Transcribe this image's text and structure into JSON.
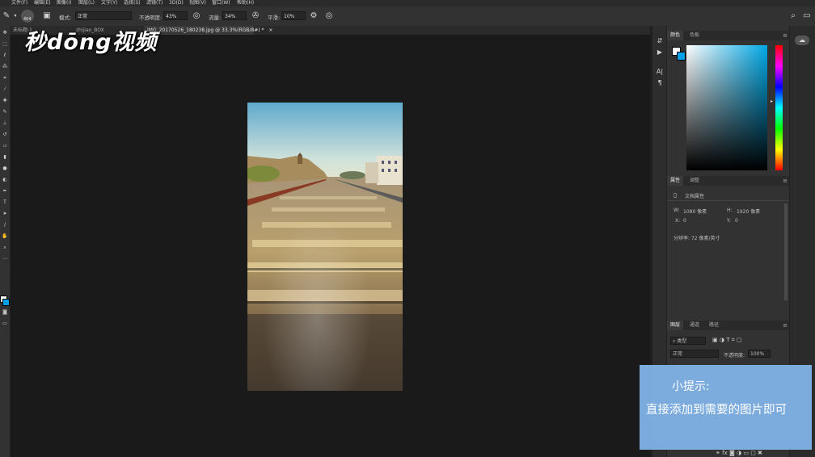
{
  "menu": [
    "文件(F)",
    "编辑(E)",
    "图像(I)",
    "图层(L)",
    "文字(Y)",
    "选择(S)",
    "滤镜(T)",
    "3D(D)",
    "视图(V)",
    "窗口(W)",
    "帮助(H)"
  ],
  "options": {
    "brush_size": "404",
    "mode_label": "模式:",
    "mode_value": "正常",
    "opacity_label": "不透明度:",
    "opacity_value": "43%",
    "flow_label": "流量:",
    "flow_value": "34%",
    "smooth_label": "平滑:",
    "smooth_value": "10%"
  },
  "tabs": [
    {
      "label": "未标题-1"
    },
    {
      "label": "zhijiao_BOX"
    },
    {
      "label": "IMG_20170526_180238.jpg @ 33.3%(RGB/8#) *"
    }
  ],
  "watermark": "秒dōng视频",
  "color_panel": {
    "tab_active": "颜色",
    "tab_other": "色板"
  },
  "properties_panel": {
    "tab_active": "属性",
    "tab_other": "调整",
    "doc_label": "文档属性",
    "w_label": "W:",
    "w_value": "1080 像素",
    "h_label": "H:",
    "h_value": "1920 像素",
    "x_label": "X:",
    "x_value": "0",
    "y_label": "Y:",
    "y_value": "0",
    "resolution": "分辨率: 72 像素/英寸"
  },
  "layers_panel": {
    "tabs": [
      "图层",
      "通道",
      "路径"
    ],
    "kind_label": "类型",
    "blend_value": "正常",
    "opacity_label": "不透明度:",
    "opacity_value": "100%"
  },
  "tip": {
    "title": "小提示:",
    "body": "直接添加到需要的图片即可"
  },
  "colors": {
    "tip_bg": "#81b2e8",
    "foreground": "#ffffff",
    "background": "#00a0e9"
  }
}
